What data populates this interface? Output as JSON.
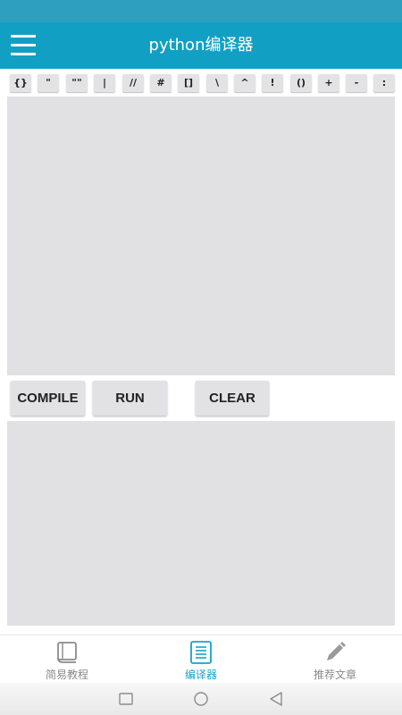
{
  "header": {
    "title": "python编译器",
    "menu_icon": "hamburger-menu-icon"
  },
  "colors": {
    "status_bar": "#2f9fc0",
    "app_bar": "#11a0c4",
    "accent": "#15a3c7",
    "panel": "#e1e0e2",
    "inactive": "#8a8a8a"
  },
  "symbols": [
    "{}",
    "\"",
    "\"\"",
    "|",
    "//",
    "#",
    "[]",
    "\\",
    "^",
    "!",
    "()",
    "+",
    "-",
    ":"
  ],
  "editor": {
    "value": "",
    "placeholder": ""
  },
  "actions": {
    "compile_label": "COMPILE",
    "run_label": "RUN",
    "clear_label": "CLEAR"
  },
  "output": {
    "text": ""
  },
  "nav": [
    {
      "label": "简易教程",
      "icon": "book-icon",
      "active": false
    },
    {
      "label": "编译器",
      "icon": "document-icon",
      "active": true
    },
    {
      "label": "推荐文章",
      "icon": "pencil-icon",
      "active": false
    }
  ],
  "system_nav": [
    "recent-apps-icon",
    "home-icon",
    "back-icon"
  ]
}
